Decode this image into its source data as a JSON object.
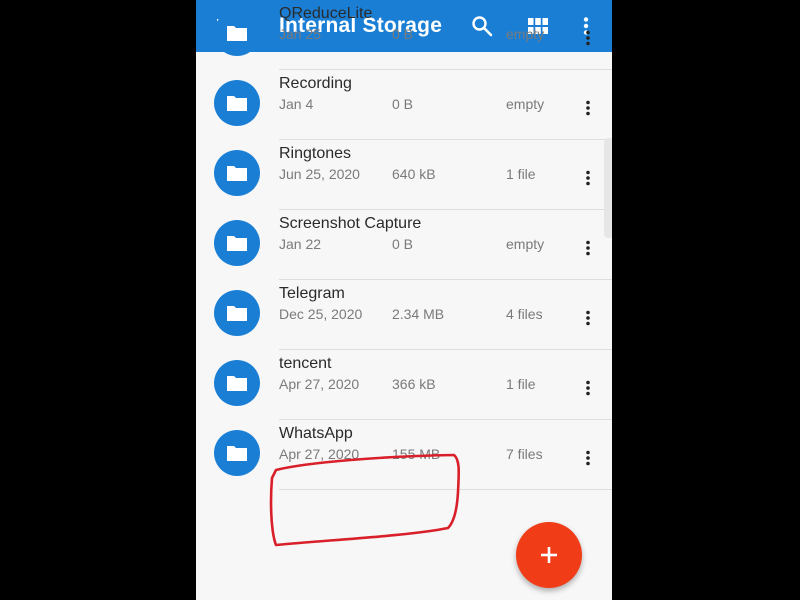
{
  "appbar": {
    "title": "Internal Storage",
    "icons": [
      "menu-icon",
      "search-icon",
      "grid-view-icon",
      "more-vert-icon"
    ],
    "color": "#1a7fd4"
  },
  "folders": [
    {
      "name": "QReduceLite",
      "date": "Jan 25",
      "size": "0 B",
      "count": "empty"
    },
    {
      "name": "Recording",
      "date": "Jan 4",
      "size": "0 B",
      "count": "empty"
    },
    {
      "name": "Ringtones",
      "date": "Jun 25, 2020",
      "size": "640 kB",
      "count": "1 file"
    },
    {
      "name": "Screenshot Capture",
      "date": "Jan 22",
      "size": "0 B",
      "count": "empty"
    },
    {
      "name": "Telegram",
      "date": "Dec 25, 2020",
      "size": "2.34 MB",
      "count": "4 files"
    },
    {
      "name": "tencent",
      "date": "Apr 27, 2020",
      "size": "366 kB",
      "count": "1 file"
    },
    {
      "name": "WhatsApp",
      "date": "Apr 27, 2020",
      "size": "155 MB",
      "count": "7 files"
    }
  ],
  "fab": {
    "icon": "plus-icon",
    "color": "#f03c17"
  },
  "annotation": {
    "highlighted_folder": "WhatsApp",
    "color": "#d9202a"
  }
}
